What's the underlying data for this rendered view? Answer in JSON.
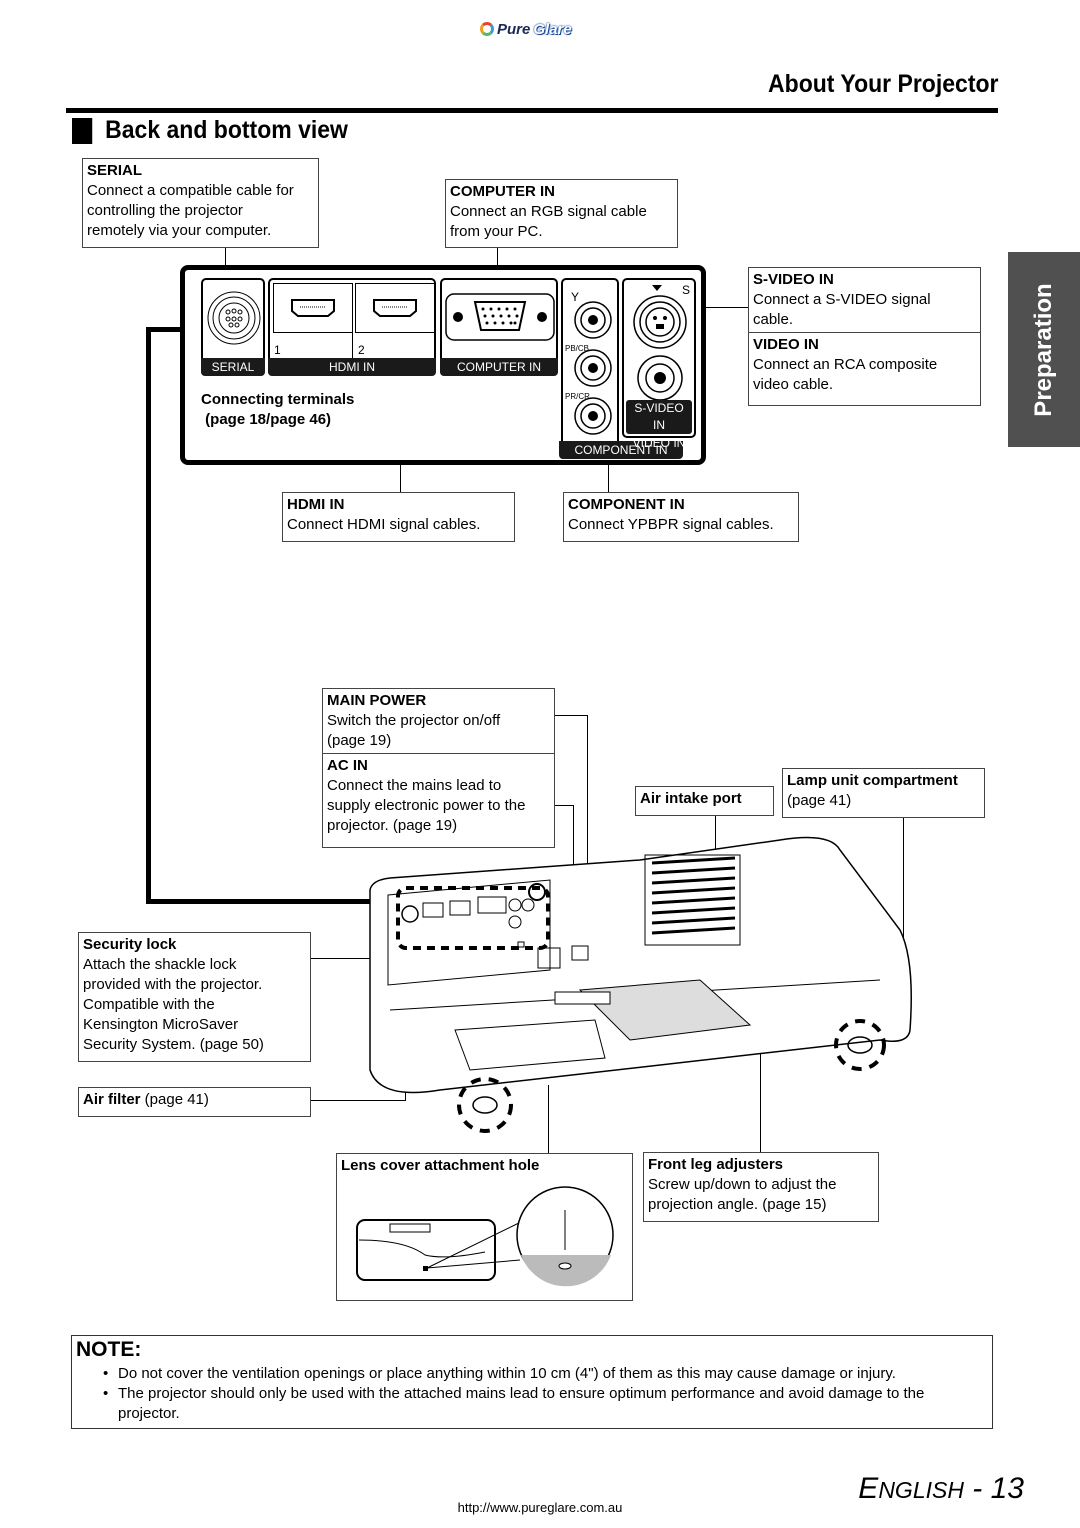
{
  "header": {
    "logo": {
      "part1": "Pure",
      "part2": "Glare",
      "icon": "pureglare-logo-icon"
    },
    "section_title": "About Your Projector",
    "subsection_title": "Back and bottom view",
    "side_tab": "Preparation"
  },
  "terminal_panel": {
    "ports": {
      "serial": "SERIAL",
      "hdmi": "HDMI IN",
      "hdmi_1": "1",
      "hdmi_2": "2",
      "computer": "COMPUTER IN",
      "component": "COMPONENT IN",
      "y": "Y",
      "pb": "PB/CB",
      "pr": "PR/CR",
      "s": "S",
      "svideo": "S-VIDEO IN",
      "video": "VIDEO IN"
    },
    "connecting_terminals": [
      "Connecting terminals",
      " (page 18/page 46)"
    ]
  },
  "callouts": {
    "serial": {
      "title": "SERIAL",
      "lines": [
        "Connect a compatible cable for",
        "controlling the projector",
        "remotely via your computer."
      ]
    },
    "computer_in": {
      "title": "COMPUTER IN",
      "lines": [
        "Connect an RGB signal cable",
        "from your PC."
      ]
    },
    "svideo_in": {
      "title": "S-VIDEO IN",
      "lines": [
        "Connect a S-VIDEO signal",
        "cable."
      ]
    },
    "video_in": {
      "title": "VIDEO IN",
      "lines": [
        "Connect an RCA composite",
        "video cable."
      ]
    },
    "hdmi_in": {
      "title": "HDMI IN",
      "lines": [
        "Connect HDMI signal cables."
      ]
    },
    "component_in": {
      "title": "COMPONENT IN",
      "lines": [
        "Connect YPBPR signal cables."
      ]
    },
    "main_power": {
      "title": "MAIN POWER",
      "lines": [
        "Switch the projector on/off",
        "(page 19)"
      ]
    },
    "ac_in": {
      "title": "AC IN",
      "lines": [
        "Connect the mains lead to",
        "supply electronic power to the",
        "projector. (page 19)"
      ]
    },
    "air_intake": {
      "title": "Air intake port"
    },
    "lamp_unit": {
      "title": "Lamp unit compartment",
      "lines": [
        "(page 41)"
      ]
    },
    "security_lock": {
      "title": "Security lock",
      "lines": [
        "Attach the shackle lock",
        "provided with the projector.",
        "Compatible with the",
        "Kensington MicroSaver",
        "Security System. (page 50)"
      ]
    },
    "air_filter": {
      "title": "Air filter",
      "suffix": " (page 41)"
    },
    "lens_cover": {
      "title": "Lens cover attachment hole"
    },
    "front_leg": {
      "title": "Front leg adjusters",
      "lines": [
        "Screw up/down to adjust the",
        "projection angle. (page 15)"
      ]
    }
  },
  "note": {
    "title": "NOTE:",
    "items": [
      "Do not cover the ventilation openings or place anything within 10 cm (4\") of them as this may cause damage or injury.",
      "The projector should only be used with the attached mains lead to ensure optimum performance and avoid damage to the projector."
    ]
  },
  "footer": {
    "url": "http://www.pureglare.com.au",
    "page_label_cap": "E",
    "page_label_rest": "NGLISH",
    "page_sep": " - ",
    "page_number": "13"
  }
}
